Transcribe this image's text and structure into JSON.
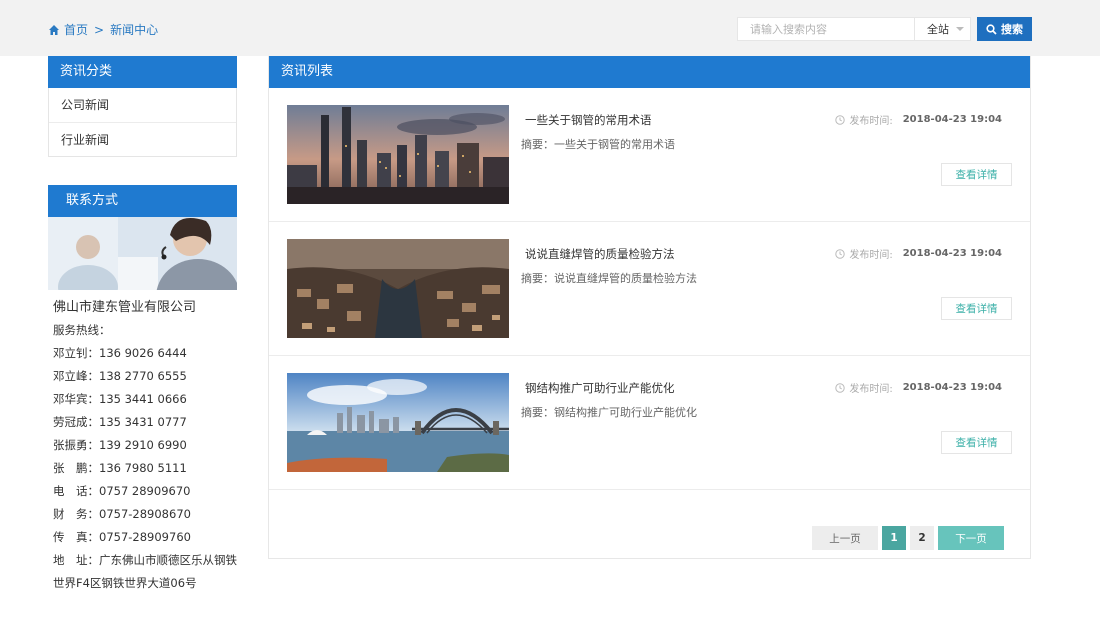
{
  "breadcrumb": {
    "home": "首页",
    "separator": ">",
    "current": "新闻中心"
  },
  "search": {
    "placeholder": "请输入搜索内容",
    "scope": "全站",
    "button": "搜索"
  },
  "sidebar": {
    "category_title": "资讯分类",
    "categories": [
      {
        "label": "公司新闻"
      },
      {
        "label": "行业新闻"
      }
    ],
    "contact_title": "联系方式",
    "company": "佛山市建东管业有限公司",
    "lines": [
      "服务热线：",
      "邓立钊：136 9026 6444",
      "邓立峰：138 2770 6555",
      "邓华宾：135 3441 0666",
      "劳冠成：135 3431 0777",
      "张振勇：139 2910 6990",
      "张　鹏：136 7980 5111",
      "电　话：0757 28909670",
      "财　务：0757-28908670",
      "传　真：0757-28909760",
      "地　址：广东佛山市顺德区乐从钢铁",
      "世界F4区钢铁世界大道06号"
    ]
  },
  "main": {
    "title": "资讯列表",
    "time_label": "发布时间:",
    "detail_label": "查看详情",
    "items": [
      {
        "title": "一些关于钢管的常用术语",
        "summary": "摘要：一些关于钢管的常用术语",
        "date": "2018-04-23 19:04"
      },
      {
        "title": "说说直缝焊管的质量检验方法",
        "summary": "摘要：说说直缝焊管的质量检验方法",
        "date": "2018-04-23 19:04"
      },
      {
        "title": "钢结构推广可助行业产能优化",
        "summary": "摘要：钢结构推广可助行业产能优化",
        "date": "2018-04-23 19:04"
      }
    ]
  },
  "pager": {
    "prev": "上一页",
    "pages": [
      "1",
      "2"
    ],
    "current": "1",
    "next": "下一页"
  },
  "colors": {
    "primary": "#1f7ad0",
    "teal": "#4aa6a0",
    "topbar": "#f2f2f2"
  }
}
